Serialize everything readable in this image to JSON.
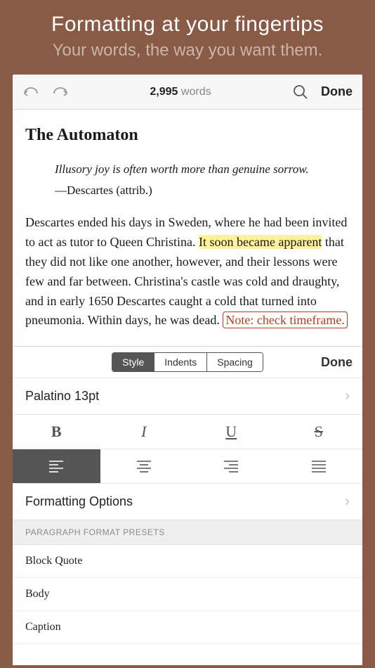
{
  "hero": {
    "title": "Formatting at your fingertips",
    "subtitle": "Your words, the way you want them."
  },
  "topbar": {
    "word_count_num": "2,995",
    "word_count_label": "words",
    "done_label": "Done"
  },
  "document": {
    "title": "The Automaton",
    "quote_text": "Illusory joy is often worth more than genuine sorrow.",
    "quote_attr": "—Descartes (attrib.)",
    "para_before_hl": "Descartes ended his days in Sweden, where he had been invited to act as tutor to Queen Christina. ",
    "para_hl": "It soon became apparent",
    "para_after_hl": " that they did not like one another, however, and their lessons were few and far between. Christina's castle was cold and draughty, and in early 1650 Descartes caught a cold that turned into pneumonia. Within days, he was dead. ",
    "annotation": "Note: check timeframe."
  },
  "format_panel": {
    "tabs": {
      "style": "Style",
      "indents": "Indents",
      "spacing": "Spacing"
    },
    "done_label": "Done",
    "font_row": "Palatino 13pt",
    "style_labels": {
      "bold": "B",
      "italic": "I",
      "underline": "U",
      "strike": "S"
    },
    "options_row": "Formatting Options",
    "preset_header": "PARAGRAPH FORMAT PRESETS",
    "presets": [
      "Block Quote",
      "Body",
      "Caption"
    ]
  }
}
